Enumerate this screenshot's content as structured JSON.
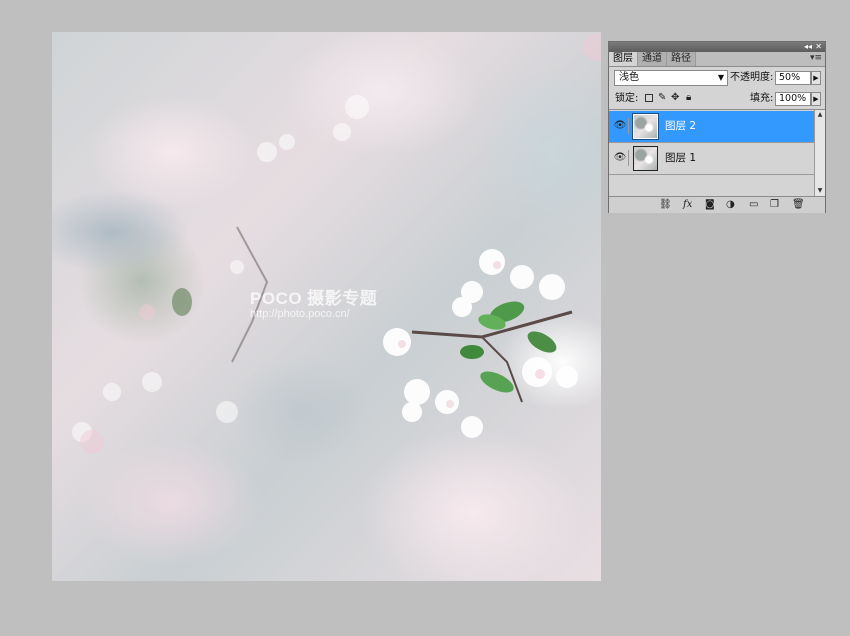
{
  "canvas": {
    "watermark_line1": "POCO 摄影专题",
    "watermark_line2": "http://photo.poco.cn/"
  },
  "panel": {
    "titlebar": {
      "collapse_icon": "double-chevron-left-icon",
      "close_icon": "close-icon"
    },
    "tabs": [
      {
        "label": "图层",
        "active": true
      },
      {
        "label": "通道",
        "active": false
      },
      {
        "label": "路径",
        "active": false
      }
    ],
    "menu_icon": "panel-menu-icon",
    "blend_mode": "浅色",
    "opacity_label": "不透明度:",
    "opacity_value": "50%",
    "lock_label": "锁定:",
    "fill_label": "填充:",
    "fill_value": "100%",
    "layers": [
      {
        "name": "图层 2",
        "selected": true,
        "visible": true
      },
      {
        "name": "图层 1",
        "selected": false,
        "visible": true
      }
    ],
    "bottom_icons": [
      "link-icon",
      "fx-icon",
      "mask-icon",
      "adjustment-icon",
      "group-folder-icon",
      "new-layer-icon",
      "trash-icon"
    ],
    "colors": {
      "selection": "#3399ff",
      "panel_bg": "#d4d4d4",
      "workspace_bg": "#bfbfbf"
    }
  }
}
